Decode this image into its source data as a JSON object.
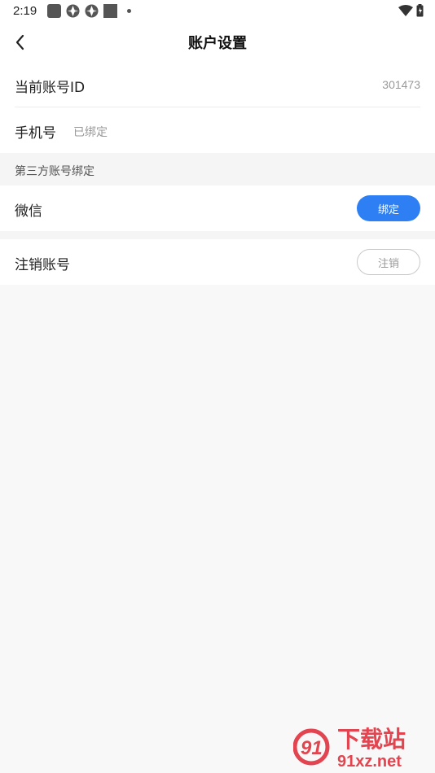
{
  "status_bar": {
    "time": "2:19"
  },
  "nav": {
    "title": "账户设置"
  },
  "account": {
    "id_label": "当前账号ID",
    "id_value": "301473",
    "phone_label": "手机号",
    "phone_status": "已绑定"
  },
  "third_party": {
    "section_title": "第三方账号绑定",
    "wechat_label": "微信",
    "bind_button": "绑定"
  },
  "cancel_account": {
    "label": "注销账号",
    "button": "注销"
  },
  "watermark": {
    "text_top": "下载站",
    "text_bottom": "91xz.net",
    "logo_digits": "91"
  },
  "colors": {
    "accent": "#2d7ff3",
    "watermark": "#e2454f"
  }
}
